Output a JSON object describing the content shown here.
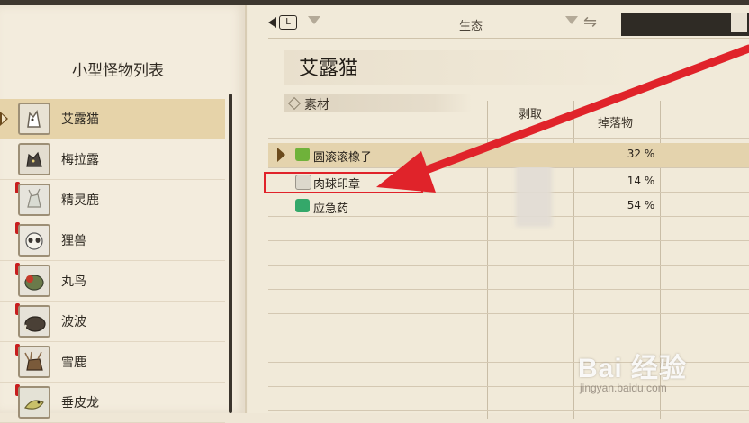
{
  "left_panel": {
    "title": "小型怪物列表",
    "monsters": [
      {
        "name": "艾露猫",
        "selected": true,
        "alert": false,
        "icon": "felyne-icon"
      },
      {
        "name": "梅拉露",
        "selected": false,
        "alert": false,
        "icon": "melynx-icon"
      },
      {
        "name": "精灵鹿",
        "selected": false,
        "alert": true,
        "icon": "kelbi-icon"
      },
      {
        "name": "狸兽",
        "selected": false,
        "alert": true,
        "icon": "raccoon-beast-icon"
      },
      {
        "name": "丸鸟",
        "selected": false,
        "alert": true,
        "icon": "round-bird-icon"
      },
      {
        "name": "波波",
        "selected": false,
        "alert": true,
        "icon": "popo-icon"
      },
      {
        "name": "雪鹿",
        "selected": false,
        "alert": true,
        "icon": "snow-deer-icon"
      },
      {
        "name": "垂皮龙",
        "selected": false,
        "alert": true,
        "icon": "dewlap-wyvern-icon"
      }
    ]
  },
  "tabs": {
    "shoulder_button": "L",
    "current_tab": "生态"
  },
  "main": {
    "monster_name": "艾露猫",
    "section_label": "素材",
    "columns": {
      "carve": "剥取",
      "drop": "掉落物"
    },
    "materials": [
      {
        "name": "圆滚滚橡子",
        "drop": "32 %",
        "selected": true,
        "icon": "acorn-icon",
        "icon_color": "#6fb23a"
      },
      {
        "name": "肉球印章",
        "drop": "14 %",
        "selected": false,
        "icon": "stamp-icon",
        "icon_color": "#d9d6cc"
      },
      {
        "name": "应急药",
        "drop": "54 %",
        "selected": false,
        "icon": "potion-icon",
        "icon_color": "#34a86a"
      }
    ]
  },
  "annotation": {
    "arrow_color": "#e0232a"
  },
  "watermark": {
    "brand": "Bai 经验",
    "url": "jingyan.baidu.com"
  }
}
